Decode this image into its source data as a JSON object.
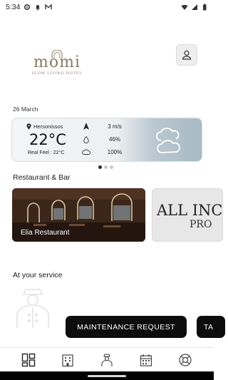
{
  "status_bar": {
    "time": "5:34"
  },
  "brand": {
    "logo_text": "momi",
    "tagline": "SLOW LIVING HOTEL"
  },
  "weather": {
    "date": "26 March",
    "location": "Hersonissos",
    "temperature": "22°C",
    "real_feel": "Real Feel : 22°C",
    "wind": "3 m/s",
    "humidity": "46%",
    "cloud_cover": "100%"
  },
  "carousel": {
    "page_count": 3,
    "active_index": 0
  },
  "restaurant_section": {
    "title": "Restaurant & Bar",
    "cards": [
      {
        "name": "Elia Restaurant"
      },
      {
        "line1": "ALL INC",
        "line2": "PRO"
      }
    ]
  },
  "service_section": {
    "title": "At your service",
    "actions": [
      {
        "label": "MAINTENANCE REQUEST"
      },
      {
        "label": "TA"
      }
    ]
  },
  "bottom_nav": {
    "items": [
      {
        "icon": "dashboard-icon"
      },
      {
        "icon": "building-icon"
      },
      {
        "icon": "concierge-icon"
      },
      {
        "icon": "calendar-icon"
      },
      {
        "icon": "lifebuoy-icon"
      }
    ]
  },
  "colors": {
    "accent_gold": "#8a7a62",
    "pill_bg": "#0d0d0d",
    "weather_gradient_end": "#a9bac4"
  }
}
